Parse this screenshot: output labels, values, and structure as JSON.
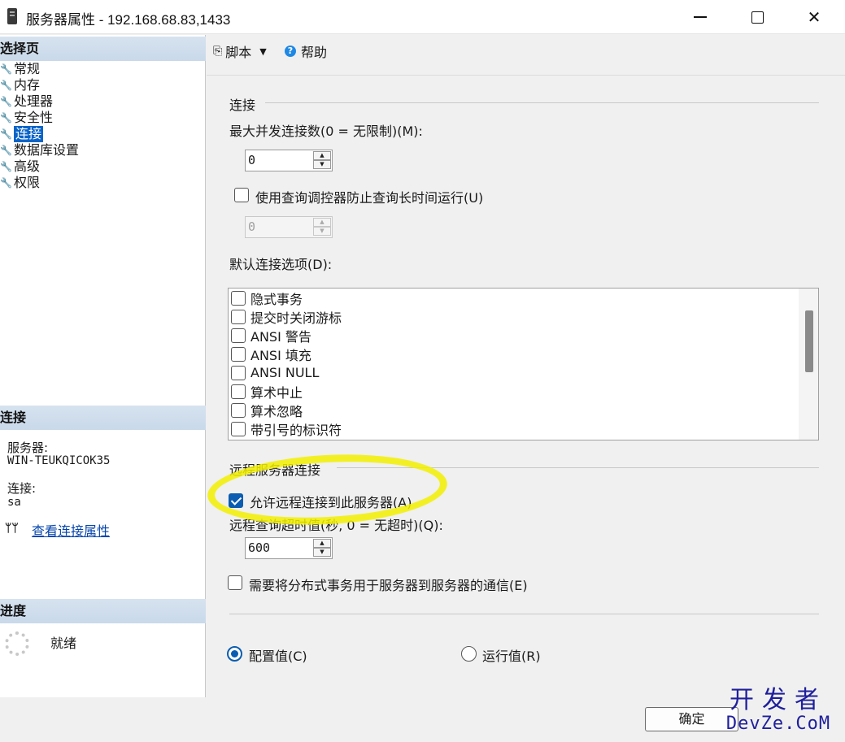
{
  "window": {
    "title": "服务器属性 - 192.168.68.83,1433",
    "icon": "server-icon"
  },
  "left": {
    "select_page_header": "选择页",
    "pages": [
      "常规",
      "内存",
      "处理器",
      "安全性",
      "连接",
      "数据库设置",
      "高级",
      "权限"
    ],
    "selected_page": "连接",
    "connection_header": "连接",
    "server_label": "服务器:",
    "server_value": "WIN-TEUKQICOK35",
    "connection_label": "连接:",
    "connection_value": "sa",
    "view_link": "查看连接属性",
    "progress_header": "进度",
    "progress_status": "就绪"
  },
  "toolbar": {
    "script_label": "脚本",
    "help_label": "帮助"
  },
  "connections": {
    "group_title": "连接",
    "max_conn_label": "最大并发连接数(0 = 无限制)(M):",
    "max_conn_value": "0",
    "query_governor_label": "使用查询调控器防止查询长时间运行(U)",
    "query_governor_checked": false,
    "query_governor_value": "0",
    "default_options_label": "默认连接选项(D):",
    "default_options": [
      {
        "label": "隐式事务",
        "checked": false
      },
      {
        "label": "提交时关闭游标",
        "checked": false
      },
      {
        "label": "ANSI 警告",
        "checked": false
      },
      {
        "label": "ANSI 填充",
        "checked": false
      },
      {
        "label": "ANSI NULL",
        "checked": false
      },
      {
        "label": "算术中止",
        "checked": false
      },
      {
        "label": "算术忽略",
        "checked": false
      },
      {
        "label": "带引号的标识符",
        "checked": false
      }
    ]
  },
  "remote": {
    "group_title": "远程服务器连接",
    "allow_remote_label": "允许远程连接到此服务器(A)",
    "allow_remote_checked": true,
    "timeout_label": "远程查询超时值(秒, 0 = 无超时)(Q):",
    "timeout_value": "600",
    "distributed_label": "需要将分布式事务用于服务器到服务器的通信(E)",
    "distributed_checked": false
  },
  "mode": {
    "configured_label": "配置值(C)",
    "running_label": "运行值(R)",
    "selected": "configured"
  },
  "footer": {
    "ok_label": "确定"
  },
  "watermark": {
    "line1": "开发者",
    "line2": "DevZe.CoM"
  },
  "colors": {
    "accent": "#0a5db0",
    "selection": "#0a64c8",
    "header_band": "#d6e2ef",
    "highlight": "#f2f000",
    "link": "#0645ad"
  }
}
